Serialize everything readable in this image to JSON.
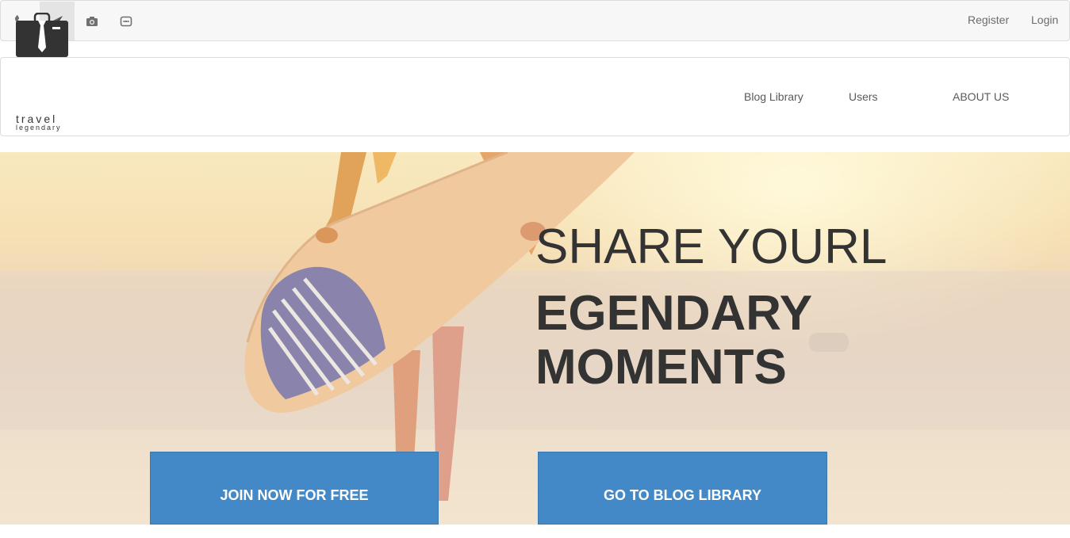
{
  "topbar": {
    "icons": [
      "phone-icon",
      "paper-plane-icon",
      "camera-icon",
      "calendar-icon"
    ],
    "register_label": "Register",
    "login_label": "Login"
  },
  "brand": {
    "name_line1": "travel",
    "name_line2": "legendary"
  },
  "nav": {
    "items": [
      "Blog Library",
      "Users",
      "ABOUT US"
    ]
  },
  "hero": {
    "line1": "SHARE YOURL",
    "line2": "EGENDARY",
    "line3": "MOMENTS",
    "cta_primary": "JOIN NOW FOR FREE",
    "cta_secondary": "GO TO BLOG LIBRARY"
  },
  "colors": {
    "accent": "#4389c8",
    "text_dark": "#333333"
  }
}
